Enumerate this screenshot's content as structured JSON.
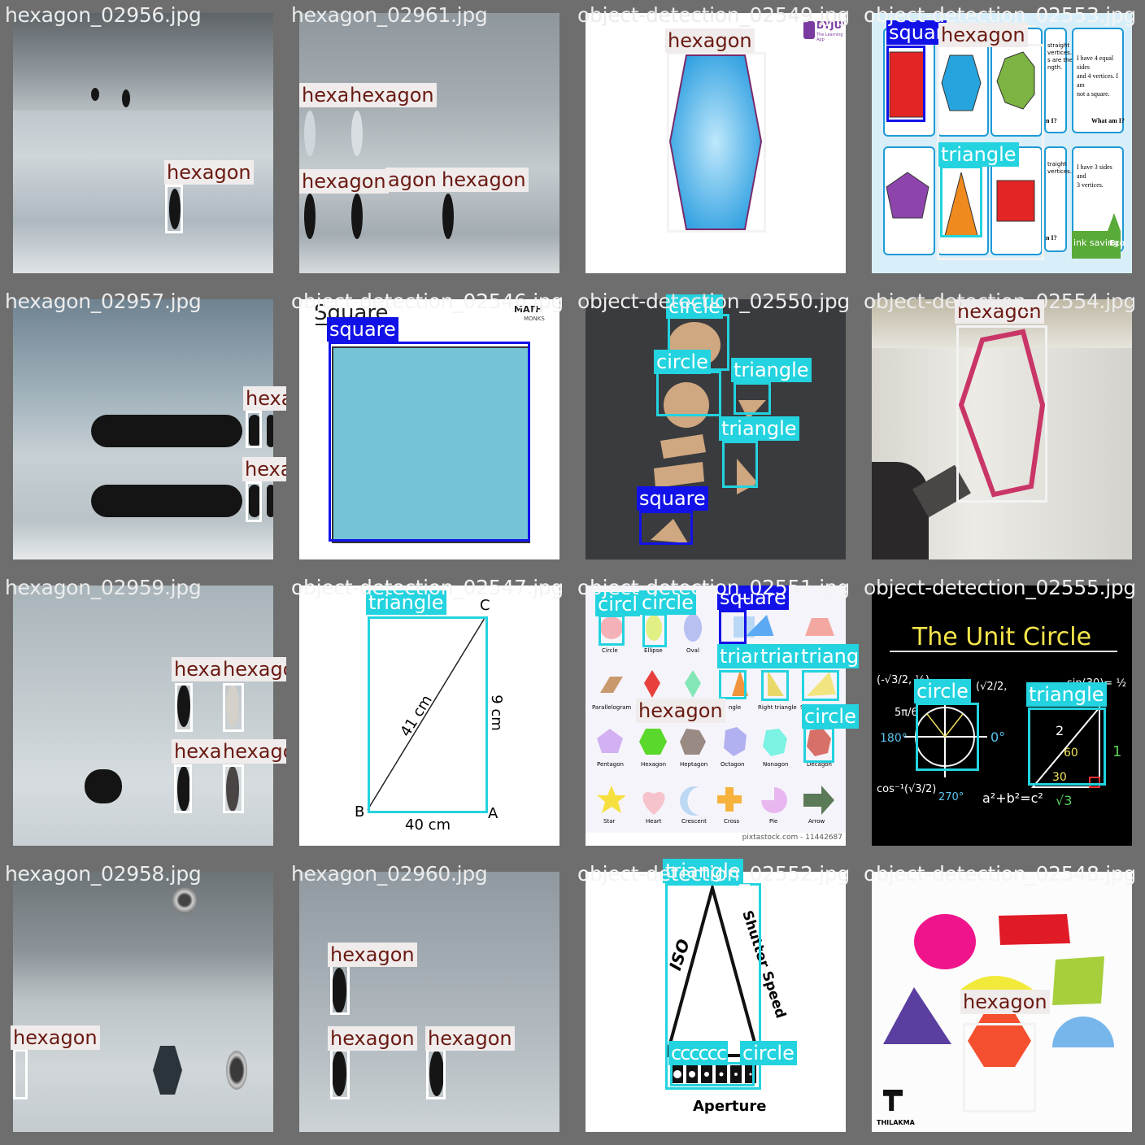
{
  "tiles": [
    {
      "filename": "hexagon_02956.jpg",
      "labels": [
        "hexagon"
      ]
    },
    {
      "filename": "hexagon_02961.jpg",
      "labels": [
        "hexa",
        "hexagon",
        "hexagon",
        "agon",
        "hexagon"
      ]
    },
    {
      "filename": "object-detection_02549.jpg",
      "labels": [
        "hexagon"
      ],
      "logo": "BYJU'S",
      "logo_sub": "The Learning App"
    },
    {
      "filename": "object-detection_02553.jpg",
      "labels": [
        "squar",
        "hexagon",
        "triangle"
      ],
      "card_texts": [
        "straight\nvertices.\ns are the\nngth.",
        "I have 4 equal sides\nand 4 vertices. I am\nnot a square.",
        "What am I?",
        "n I?",
        "traight\nvertices.",
        "I have 3 sides and\n3 vertices.",
        "n I?",
        "ink saving",
        "Eco"
      ]
    },
    {
      "filename": "hexagon_02957.jpg",
      "labels": [
        "hexagon",
        "hexagon"
      ]
    },
    {
      "filename": "object-detection_02546.jpg",
      "labels": [
        "square"
      ],
      "heading": "Square",
      "logo": "MATH",
      "logo_sub": "MONKS"
    },
    {
      "filename": "object-detection_02550.jpg",
      "labels": [
        "circle",
        "circle",
        "triangle",
        "triangle",
        "square"
      ]
    },
    {
      "filename": "object-detection_02554.jpg",
      "labels": [
        "hexagon"
      ]
    },
    {
      "filename": "hexagon_02959.jpg",
      "labels": [
        "hexa",
        "hexagon",
        "hexa",
        "hexagon"
      ]
    },
    {
      "filename": "object-detection_02547.jpg",
      "labels": [
        "triangle"
      ],
      "diagram": {
        "c": "C",
        "b": "B",
        "a": "A",
        "hyp": "41 cm",
        "side": "9 cm",
        "base": "40 cm"
      }
    },
    {
      "filename": "object-detection_02551.jpg",
      "labels": [
        "circl",
        "circle",
        "square",
        "triar",
        "trian",
        "triangle",
        "hexagon",
        "circle"
      ],
      "shape_names": [
        "Circle",
        "Ellipse",
        "Oval",
        "Parallelogram",
        "Pentagon",
        "Hexagon",
        "Heptagon",
        "Octagon",
        "Nonagon",
        "Decagon",
        "Star",
        "Heart",
        "Crescent",
        "Cross",
        "Pie",
        "Arrow",
        "ngle",
        "Right triangle",
        "S"
      ],
      "footer": "pixtastock.com - 11442687"
    },
    {
      "filename": "object-detection_02555.jpg",
      "labels": [
        "circle",
        "triangle"
      ],
      "title": "The Unit Circle",
      "formula": "a²+b²=c²"
    },
    {
      "filename": "hexagon_02958.jpg",
      "labels": [
        "hexagon"
      ]
    },
    {
      "filename": "hexagon_02960.jpg",
      "labels": [
        "hexagon",
        "hexagon",
        "hexagon"
      ]
    },
    {
      "filename": "object-detection_02552.jpg",
      "labels": [
        "triangle",
        "cccccc",
        "circle"
      ],
      "iso": "ISO",
      "shutter": "Shutter Speed",
      "aperture": "Aperture"
    },
    {
      "filename": "object-detection_02548.jpg",
      "labels": [
        "hexagon"
      ],
      "logo": "THILAKMA"
    }
  ],
  "colors": {
    "hexagon_box": "#ffffff",
    "circle_box": "#23d3df",
    "triangle_box": "#23d3df",
    "square_box": "#1212e8",
    "hexagon_label_bg": "#f0ecec",
    "hexagon_label_fg": "#6a1a12"
  }
}
